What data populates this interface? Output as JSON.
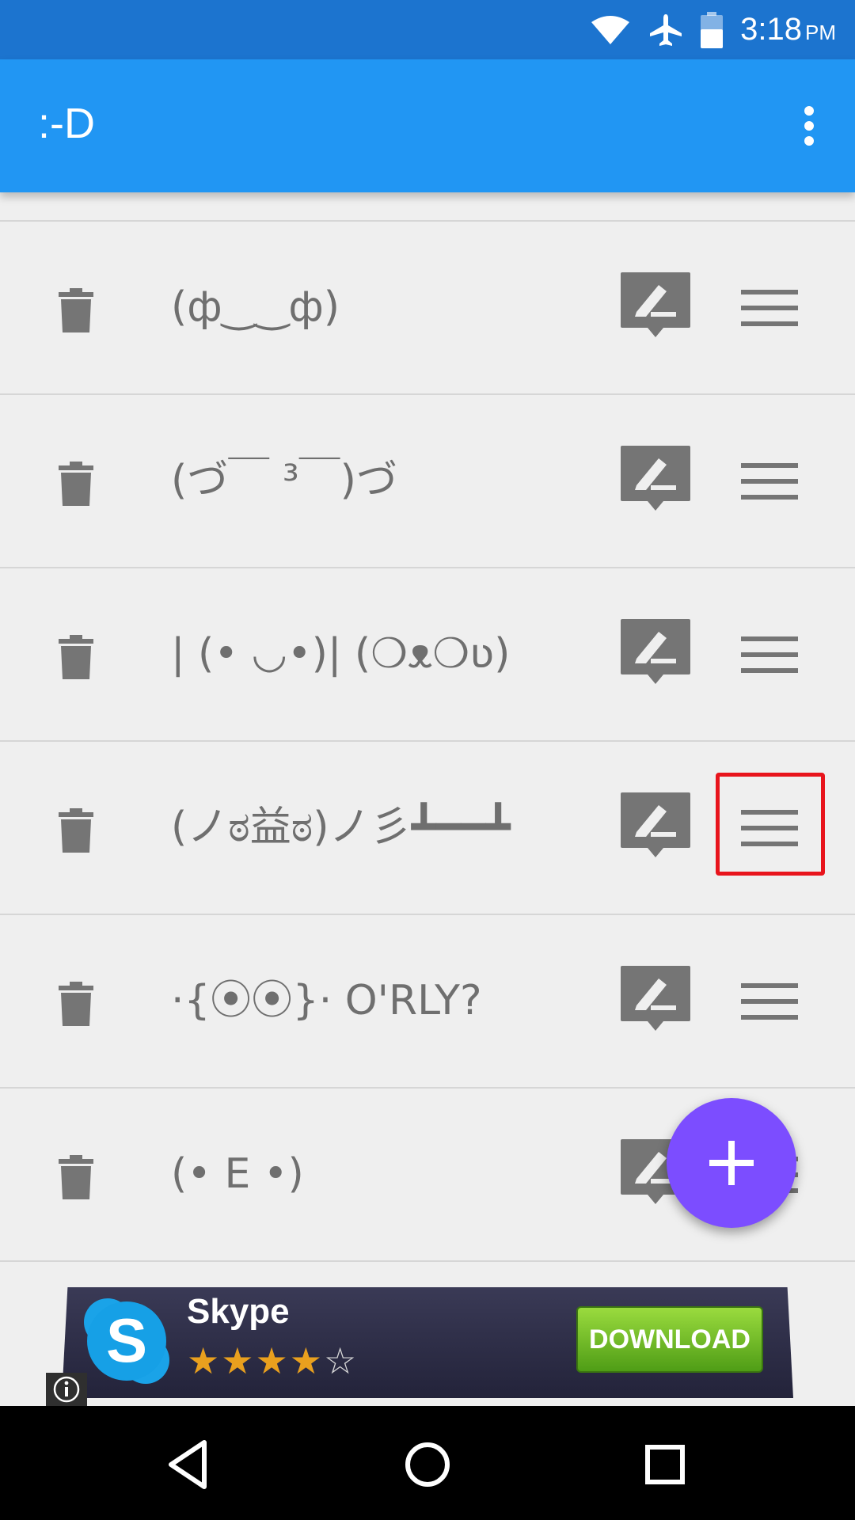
{
  "status_bar": {
    "time": "3:18",
    "ampm": "PM",
    "icons": [
      "wifi-icon",
      "airplane-mode-icon",
      "battery-icon"
    ]
  },
  "app_bar": {
    "title": ":-D",
    "overflow_icon": "more-vert-icon",
    "color": "#2196f3"
  },
  "emoticons": [
    "(ф‿‿ф)",
    "(づ￣ ³￣)づ",
    "| (• ◡•)| (❍ᴥ❍ʋ)",
    "(ノಠ益ಠ)ノ彡┻━━┻",
    "⋅{⦿⦿}⋅ O'RLY?",
    "(• E •)"
  ],
  "row_icons": {
    "delete": "trash-icon",
    "edit": "edit-bubble-icon",
    "drag": "drag-handle-icon"
  },
  "fab": {
    "icon": "plus-icon",
    "color": "#7c4dff"
  },
  "ad": {
    "app_name": "Skype",
    "rating": 4,
    "max_rating": 5,
    "stars_filled": "★★★★",
    "stars_empty": "☆",
    "button_label": "DOWNLOAD",
    "info_icon": "info-icon",
    "logo_letter": "S"
  },
  "nav_bar": {
    "back_icon": "back-icon",
    "home_icon": "home-icon",
    "recents_icon": "recents-icon"
  },
  "highlight_color": "#e8141c"
}
